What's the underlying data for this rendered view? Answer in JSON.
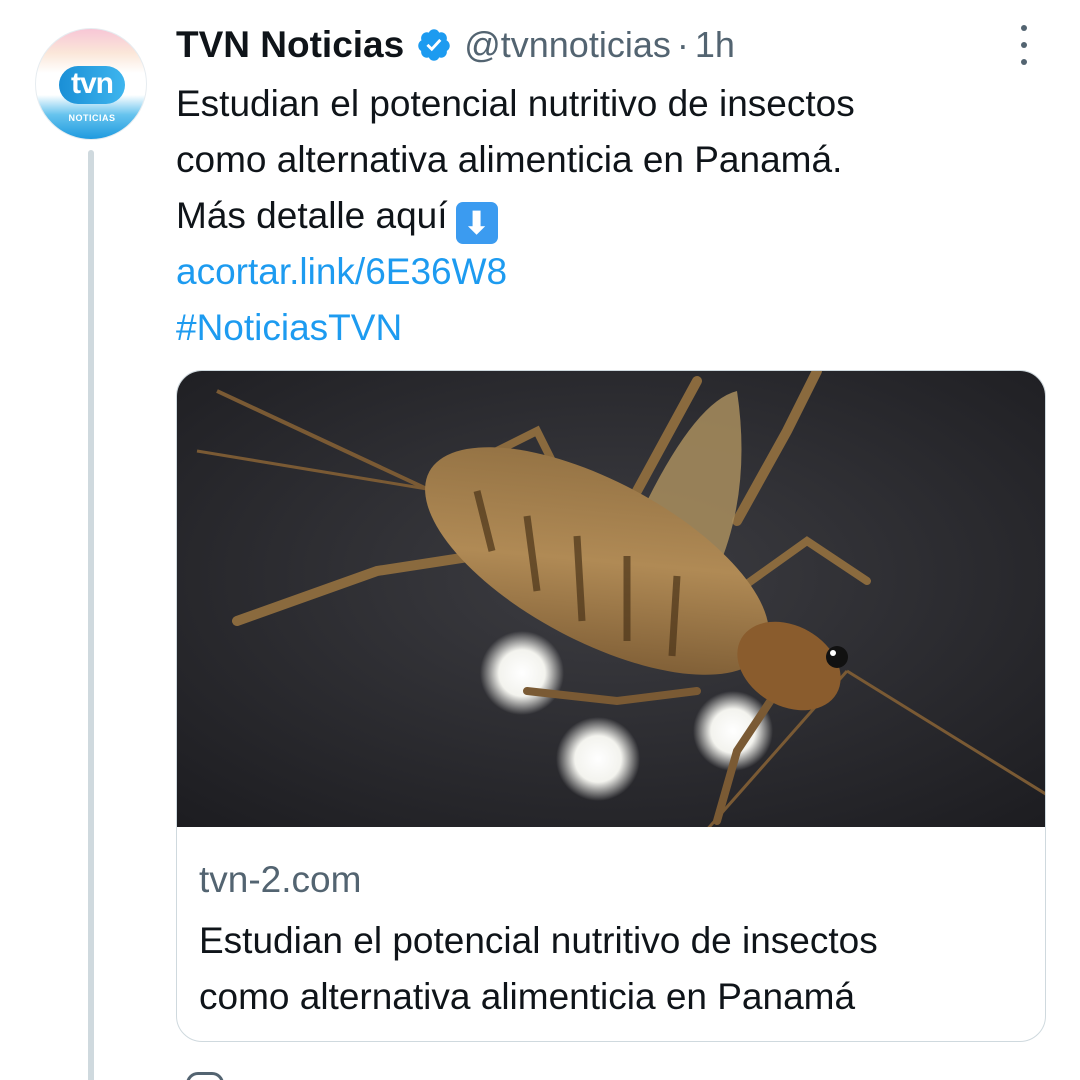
{
  "tweet": {
    "display_name": "TVN Noticias",
    "handle": "@tvnnoticias",
    "separator": "·",
    "time": "1h",
    "verified": true,
    "avatar": {
      "logo_text": "tvn",
      "sub_text": "NOTICIAS"
    },
    "text_lines": [
      "Estudian el potencial nutritivo de insectos",
      "como alternativa alimenticia en Panamá.",
      "Más detalle aquí"
    ],
    "emoji": "⬇",
    "link": "acortar.link/6E36W8",
    "hashtag": "#NoticiasTVN",
    "more_icon": "more-vertical-icon"
  },
  "card": {
    "domain": "tvn-2.com",
    "title_lines": [
      "Estudian el potencial nutritivo de insectos",
      "como alternativa alimenticia en Panamá"
    ],
    "image_subject": "cricket-photo"
  },
  "colors": {
    "link": "#1d9bf0",
    "secondary_text": "#536471",
    "primary_text": "#0f1419",
    "verified_badge": "#1d9bf0",
    "thread_line": "#cfd9de"
  }
}
